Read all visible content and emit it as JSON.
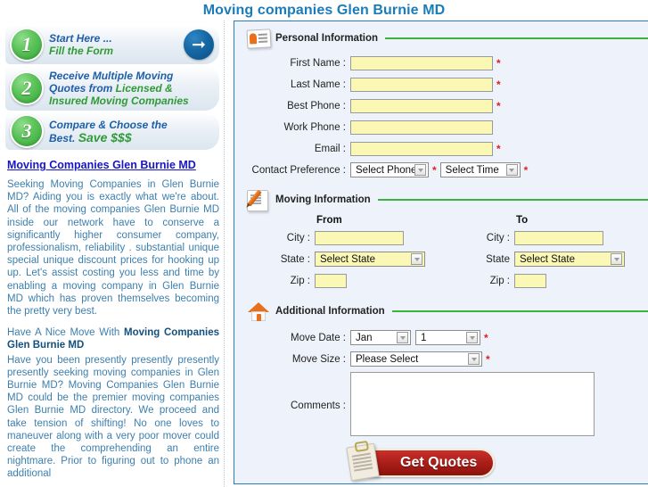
{
  "page": {
    "title": "Moving companies Glen Burnie MD"
  },
  "sidebar": {
    "steps": [
      {
        "number": "1",
        "line1": "Start Here ...",
        "line2": "Fill the Form",
        "arrow_icon": "arrow-right-icon"
      },
      {
        "number": "2",
        "line1": "Receive Multiple Moving",
        "line2": "Quotes from ",
        "line2b": "Licensed &",
        "line3": "Insured Moving Companies"
      },
      {
        "number": "3",
        "line1": "Compare & Choose the",
        "line2": "Best. ",
        "line2b": "Save $$$"
      }
    ],
    "link": "Moving Companies Glen Burnie MD",
    "paragraph1": "Seeking Moving Companies in Glen Burnie MD? Aiding you is exactly what we're about. All of the moving companies Glen Burnie MD inside our network have to conserve a significantly higher consumer company, professionalism, reliability . substantial unique special unique discount prices for hooking up up. Let's assist costing you less and time by enabling a moving company in Glen Burnie MD which has proven themselves becoming the pretty very best.",
    "heading2_prefix": "Have A Nice Move With ",
    "heading2_bold": "Moving Companies Glen Burnie MD",
    "paragraph2": "Have you been presently presently presently presently seeking moving companies in Glen Burnie MD? Moving Companies Glen Burnie MD could be the premier moving companies Glen Burnie MD directory. We proceed and take tension of shifting! No one loves to maneuver along with a very poor mover could create the comprehending an entire nightmare. Prior to figuring out to phone an additional"
  },
  "form": {
    "personal": {
      "icon": "id-card-icon",
      "title": "Personal Information",
      "fields": [
        {
          "label": "First Name :",
          "value": "",
          "required": "*"
        },
        {
          "label": "Last Name :",
          "value": "",
          "required": "*"
        },
        {
          "label": "Best Phone :",
          "value": "",
          "required": "*"
        },
        {
          "label": "Work Phone :",
          "value": "",
          "required": ""
        },
        {
          "label": "Email :",
          "value": "",
          "required": "*"
        }
      ],
      "contact_preference": {
        "label": "Contact Preference :",
        "phone_value": "Select Phone",
        "phone_required": "*",
        "time_value": "Select Time",
        "time_required": "*"
      }
    },
    "moving": {
      "icon": "pencil-paper-icon",
      "title": "Moving Information",
      "from": {
        "heading": "From",
        "city_label": "City :",
        "city_value": "",
        "state_label": "State :",
        "state_value": "Select State",
        "zip_label": "Zip :",
        "zip_value": ""
      },
      "to": {
        "heading": "To",
        "city_label": "City :",
        "city_value": "",
        "state_label": "State",
        "state_value": "Select State",
        "zip_label": "Zip :",
        "zip_value": ""
      }
    },
    "additional": {
      "icon": "house-icon",
      "title": "Additional Information",
      "move_date": {
        "label": "Move Date :",
        "month_value": "Jan",
        "day_value": "1",
        "required": "*"
      },
      "move_size": {
        "label": "Move Size :",
        "value": "Please Select",
        "required": "*"
      },
      "comments": {
        "label": "Comments :",
        "value": ""
      }
    },
    "submit": {
      "label": "Get Quotes",
      "icon": "clipboard-icon"
    }
  },
  "colors": {
    "title_blue": "#1b7cba",
    "panel_border": "#2d7cc0",
    "panel_bg": "#eef3fb",
    "rule_green": "#3bb33b",
    "input_yellow": "#fbf8b5",
    "required_red": "#e02020",
    "step_green": "#35a63a",
    "step_blue_text": "#1f5fa8",
    "link_blue": "#1616c8",
    "body_blue": "#3c7fae",
    "button_red": "#a71d17"
  }
}
